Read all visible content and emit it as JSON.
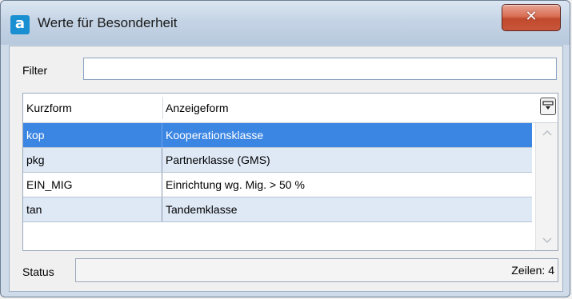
{
  "window": {
    "title": "Werte für Besonderheit",
    "app_icon_letter": "a",
    "close_glyph": "✕"
  },
  "filter": {
    "label": "Filter",
    "value": "",
    "placeholder": ""
  },
  "grid": {
    "columns": [
      "Kurzform",
      "Anzeigeform"
    ],
    "column_chooser_icon": "column-chooser-icon",
    "rows": [
      {
        "kurzform": "kop",
        "anzeigeform": "Kooperationsklasse",
        "selected": true
      },
      {
        "kurzform": "pkg",
        "anzeigeform": "Partnerklasse (GMS)",
        "selected": false
      },
      {
        "kurzform": "EIN_MIG",
        "anzeigeform": "Einrichtung wg. Mig. > 50 %",
        "selected": false
      },
      {
        "kurzform": "tan",
        "anzeigeform": "Tandemklasse",
        "selected": false
      }
    ]
  },
  "status": {
    "label": "Status",
    "text": "",
    "rows_count_text": "Zeilen: 4"
  },
  "colors": {
    "selection": "#3c86e3",
    "row_alt": "#dfe9f6",
    "close_button": "#c8563b",
    "title_bar": "#c5d4e5"
  }
}
